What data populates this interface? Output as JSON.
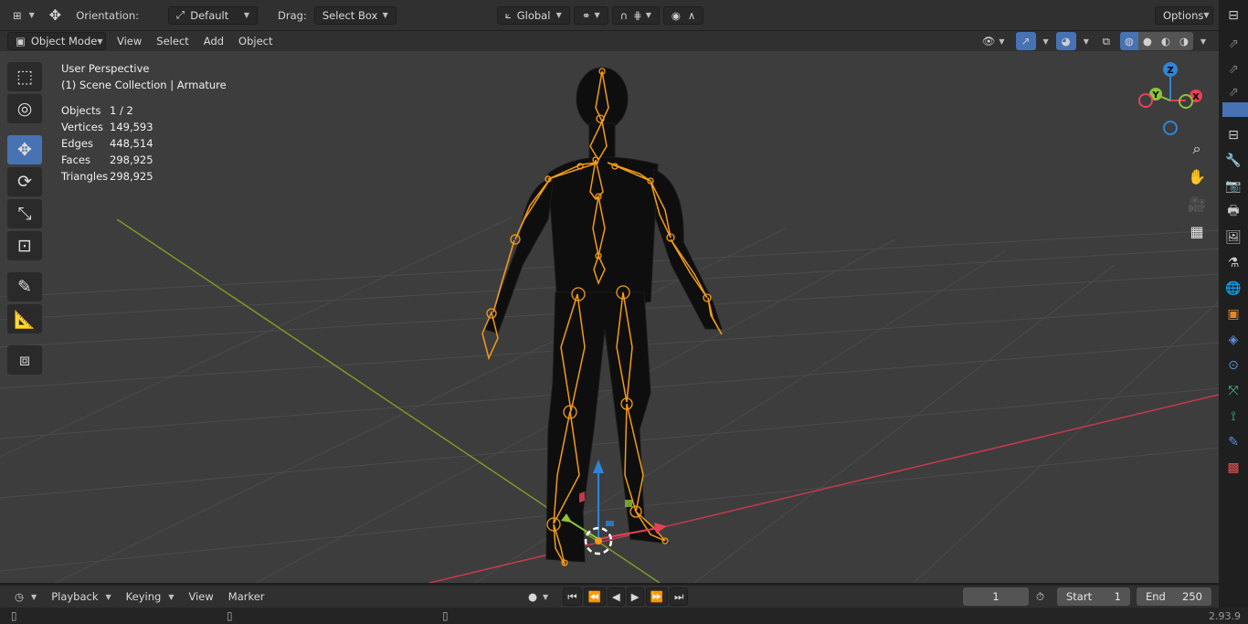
{
  "topbar": {
    "orientation_label": "Orientation:",
    "orientation_value": "Default",
    "drag_label": "Drag:",
    "drag_value": "Select Box",
    "transform_space": "Global",
    "options_label": "Options"
  },
  "header": {
    "mode": "Object Mode",
    "menus": [
      "View",
      "Select",
      "Add",
      "Object"
    ]
  },
  "overlay": {
    "view_name": "User Perspective",
    "collection": "(1) Scene Collection | Armature",
    "stats": [
      {
        "key": "Objects",
        "value": "1 / 2"
      },
      {
        "key": "Vertices",
        "value": "149,593"
      },
      {
        "key": "Edges",
        "value": "448,514"
      },
      {
        "key": "Faces",
        "value": "298,925"
      },
      {
        "key": "Triangles",
        "value": "298,925"
      }
    ]
  },
  "gizmo": {
    "x": "X",
    "y": "Y",
    "z": "Z"
  },
  "timeline": {
    "menus": [
      "Playback",
      "Keying",
      "View",
      "Marker"
    ],
    "current_frame": "1",
    "start_label": "Start",
    "start_value": "1",
    "end_label": "End",
    "end_value": "250"
  },
  "status": {
    "version": "2.93.9"
  },
  "colors": {
    "accent": "#4772b3",
    "armature": "#f39b1a",
    "x_axis": "#e8405a",
    "y_axis": "#8cc43a",
    "z_axis": "#2f85d7"
  },
  "icons": {
    "tools": [
      "select-box-icon",
      "cursor-icon",
      "move-icon",
      "rotate-icon",
      "scale-icon",
      "transform-icon",
      "annotate-icon",
      "measure-icon",
      "add-cube-icon"
    ],
    "nav": [
      "zoom-icon",
      "hand-pan-icon",
      "camera-icon",
      "grid-perspective-icon"
    ]
  }
}
